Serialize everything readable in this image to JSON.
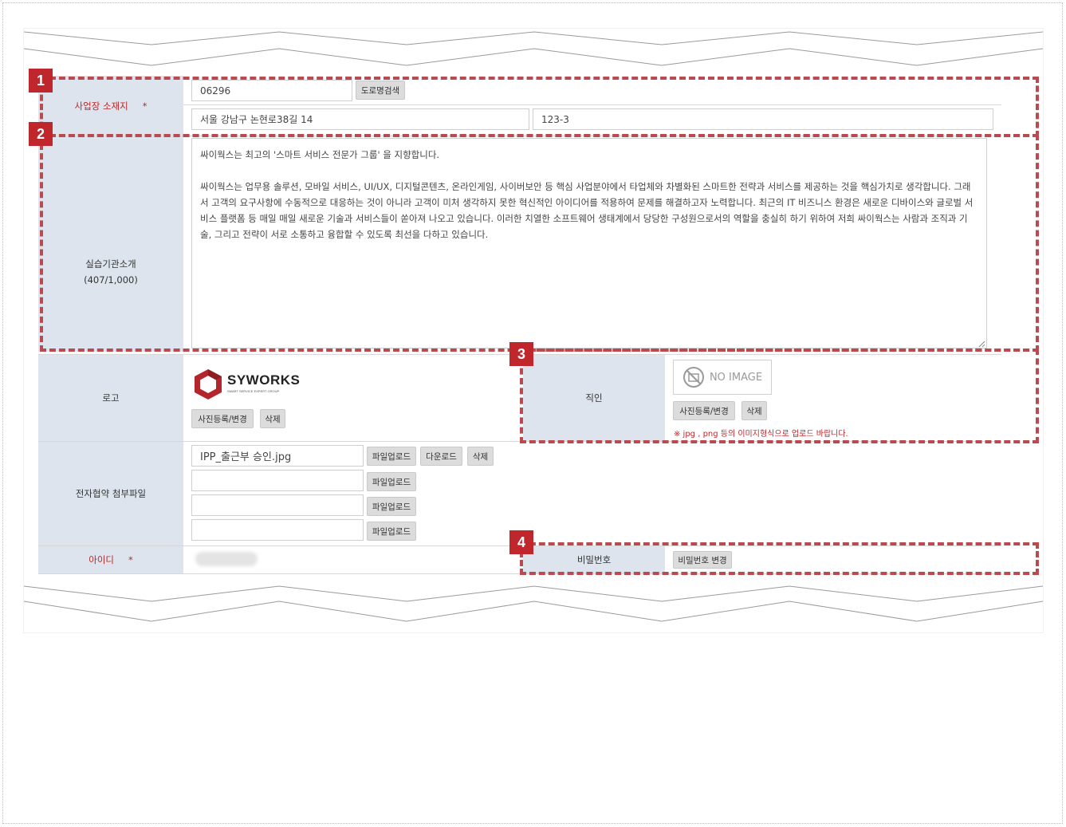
{
  "address": {
    "label": "사업장 소재지",
    "required_mark": "*",
    "postcode": "06296",
    "search_button": "도로명검색",
    "road_address": "서울 강남구 논현로38길 14",
    "detail_address": "123-3"
  },
  "intro": {
    "label": "실습기관소개",
    "count": "(407/1,000)",
    "paragraph1": "싸이웍스는 최고의 '스마트 서비스 전문가 그룹' 을 지향합니다.",
    "paragraph2": "싸이웍스는 업무용 솔루션, 모바일 서비스, UI/UX, 디지털콘텐츠, 온라인게임, 사이버보안 등 핵심 사업분야에서 타업체와 차별화된 스마트한 전략과 서비스를 제공하는 것을 핵심가치로 생각합니다. 그래서 고객의 요구사항에 수동적으로 대응하는 것이 아니라 고객이 미처 생각하지 못한 혁신적인 아이디어를 적용하여 문제를 해결하고자 노력합니다. 최근의 IT 비즈니스 환경은 새로운 디바이스와 글로벌 서비스 플랫폼 등 매일 매일 새로운 기술과 서비스들이 쏟아져 나오고 있습니다. 이러한 치열한 소프트웨어 생태계에서 당당한 구성원으로서의 역할을 충실히 하기 위하여 저희 싸이웍스는 사람과 조직과 기술, 그리고 전략이 서로 소통하고 융합할 수 있도록 최선을 다하고 있습니다."
  },
  "logo": {
    "label": "로고",
    "brand": "SYWORKS",
    "tagline": "SMART SERVICE EXPERT GROUP",
    "change_button": "사진등록/변경",
    "delete_button": "삭제"
  },
  "seal": {
    "label": "직인",
    "no_image_text": "NO IMAGE",
    "change_button": "사진등록/변경",
    "delete_button": "삭제",
    "hint": "※ jpg , png 등의 이미지형식으로 업로드 바랍니다."
  },
  "attachments": {
    "label": "전자협약 첨부파일",
    "files": [
      "IPP_출근부 승인.jpg",
      "",
      "",
      ""
    ],
    "upload_button": "파일업로드",
    "download_button": "다운로드",
    "delete_button": "삭제"
  },
  "account": {
    "id_label": "아이디",
    "required_mark": "*",
    "password_label": "비밀번호",
    "password_button": "비밀번호 변경"
  },
  "callouts": [
    "1",
    "2",
    "3",
    "4"
  ],
  "colors": {
    "label_bg": "#dde4ee",
    "callout": "#b94a4f",
    "marker": "#c0272d",
    "required": "#b52a2a"
  }
}
